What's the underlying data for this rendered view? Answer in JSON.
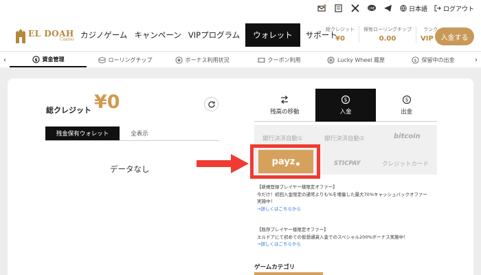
{
  "topbar": {
    "language": "日本語",
    "logout": "ログアウト"
  },
  "logo": {
    "name": "EL DOAH",
    "sub": "Casino"
  },
  "nav": {
    "items": [
      "カジノゲーム",
      "キャンペーン",
      "VIPプログラム",
      "ウォレット",
      "サポート"
    ],
    "active_index": 3
  },
  "stats": {
    "credit_label": "総クレジット",
    "credit_value": "¥0",
    "rolling_label": "保有ローリングチップ",
    "rolling_value": "0.00",
    "rank_label": "ランク",
    "rank_value": "VIP 1"
  },
  "deposit_button": "入金する",
  "subnav": {
    "items": [
      "資金管理",
      "ローリングチップ",
      "ボーナス利用状況",
      "クーポン利用",
      "Lucky Wheel 履歴",
      "保留中の出金"
    ]
  },
  "wallet": {
    "credit_label": "総クレジット",
    "credit_value": "¥0",
    "tab_active": "残金保有ウォレット",
    "tab_other": "全表示",
    "empty": "データなし"
  },
  "right_tabs": [
    "残高の移動",
    "入金",
    "出金"
  ],
  "methods": {
    "bank1": "銀行決済自動①",
    "bank2": "銀行決済自動②",
    "bitcoin": "bitcoin",
    "payz": "payz",
    "sticpay": "STICPAY",
    "credit_card": "クレジットカード"
  },
  "promos": {
    "p1_title": "【新規登録プレイヤー様限定オファー】",
    "p1_line1": "今だけ！初回入金限定の通常よりも%を増量した最大70%キャッシュバックオファー",
    "p1_line2": "実施中！",
    "p1_link": "→詳しくはこちらから",
    "p2_title": "【既存プレイヤー様限定オファー】",
    "p2_line1": "エルドアにて初めての仮想通貨入金でのスペシャル200%ボーナス実施中！",
    "p2_link": "→詳しくはこちらから"
  },
  "game_category": "ゲームカテゴリ",
  "colors": {
    "gold": "#cf9a4f",
    "highlight_red": "#ef3b32",
    "payz_bg": "#d6a15d"
  }
}
